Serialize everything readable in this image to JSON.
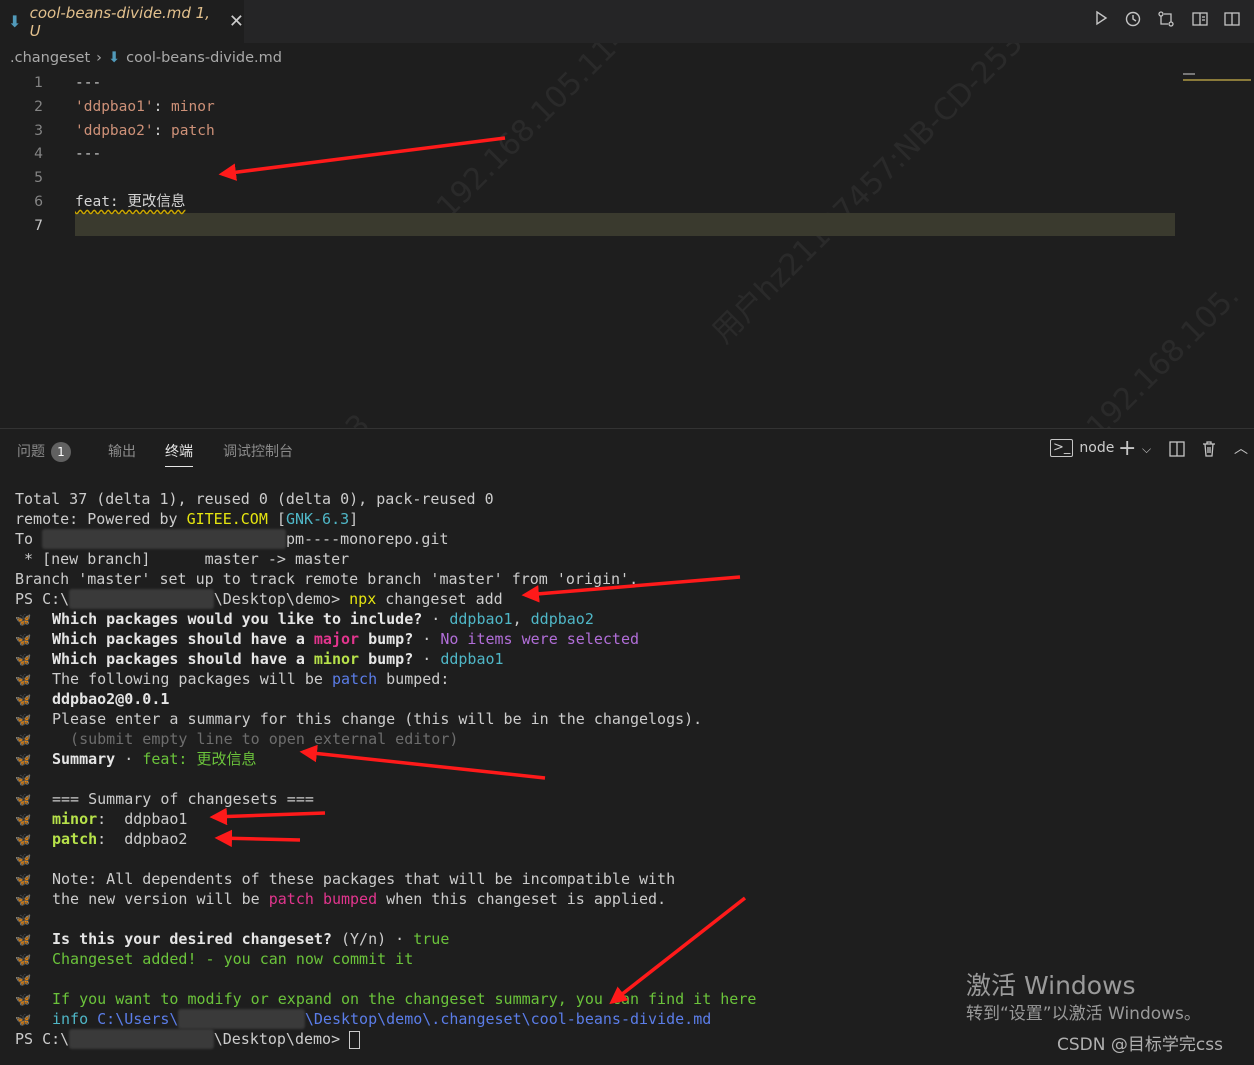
{
  "tab": {
    "icon": "markdown-file-icon",
    "label": "cool-beans-divide.md 1, U",
    "close": "✕"
  },
  "breadcrumb": {
    "folder": ".changeset",
    "file": "cool-beans-divide.md"
  },
  "editor": {
    "lines": [
      {
        "no": "1",
        "text": "---"
      },
      {
        "no": "2",
        "key": "'ddpbao1'",
        "colon": ":",
        "value": " minor"
      },
      {
        "no": "3",
        "key": "'ddpbao2'",
        "colon": ":",
        "value": " patch"
      },
      {
        "no": "4",
        "text": "---"
      },
      {
        "no": "5",
        "text": ""
      },
      {
        "no": "6",
        "text": "feat: 更改信息"
      },
      {
        "no": "7",
        "text": ""
      }
    ]
  },
  "panel": {
    "tabs": [
      {
        "label": "问题",
        "badge": "1"
      },
      {
        "label": "输出"
      },
      {
        "label": "终端",
        "active": true
      },
      {
        "label": "调试控制台"
      }
    ],
    "profile": "node"
  },
  "terminal": {
    "l1": "Total 37 (delta 1), reused 0 (delta 0), pack-reused 0",
    "l2a": "remote: Powered by ",
    "l2b": "GITEE.COM",
    "l2c": " [",
    "l2d": "GNK-6.3",
    "l2e": "]",
    "l3a": "To ",
    "l3b": "pm----monorepo.git",
    "l4": " * [new branch]      master -> master",
    "l5": "Branch 'master' set up to track remote branch 'master' from 'origin'.",
    "p1a": "PS C:\\",
    "p1b": "\\Desktop\\demo> ",
    "p1c": "npx",
    "p1d": " changeset add",
    "q1a": "Which packages would you like to include?",
    "q1b": " · ",
    "q1c": "ddpbao1",
    "q1d": ", ",
    "q1e": "ddpbao2",
    "q2a": "Which packages should have a ",
    "q2b": "major",
    "q2c": " bump?",
    "q2d": " · ",
    "q2e": "No items were selected",
    "q3a": "Which packages should have a ",
    "q3b": "minor",
    "q3c": " bump?",
    "q3d": " · ",
    "q3e": "ddpbao1",
    "f1a": "The following packages will be ",
    "f1b": "patch",
    "f1c": " bumped:",
    "f2": "ddpbao2@0.0.1",
    "s1": "Please enter a summary for this change (this will be in the changelogs).",
    "s2": "  (submit empty line to open external editor)",
    "s3a": "Summary",
    "s3b": " · ",
    "s3c": "feat: 更改信息",
    "h1": "=== Summary of changesets ===",
    "m1a": "minor",
    "m1b": ":  ddpbao1",
    "m2a": "patch",
    "m2b": ":  ddpbao2",
    "n1": "Note: All dependents of these packages that will be incompatible with",
    "n2a": "the new version will be ",
    "n2b": "patch",
    "n2c": " ",
    "n2d": "bumped",
    "n2e": " when this changeset is applied.",
    "c1a": "Is this your desired changeset?",
    "c1b": " (Y/n)",
    "c1c": " · ",
    "c1d": "true",
    "c2": "Changeset added! - you can now commit it",
    "i1": "If you want to modify or expand on the changeset summary, you can find it here",
    "i2a": "info",
    "i2b": " C:\\Users\\",
    "i2c": "\\Desktop\\demo\\.changeset\\cool-beans-divide.md",
    "p2a": "PS C:\\",
    "p2b": "\\Desktop\\demo> "
  },
  "overlay": {
    "activate_title": "激活 Windows",
    "activate_sub": "转到“设置”以激活 Windows。",
    "csdn": "CSDN @目标学完css"
  },
  "colors": {
    "arrow": "#ff1a1a",
    "bg": "#1e1e1e",
    "tab_label": "#e2c08d"
  }
}
